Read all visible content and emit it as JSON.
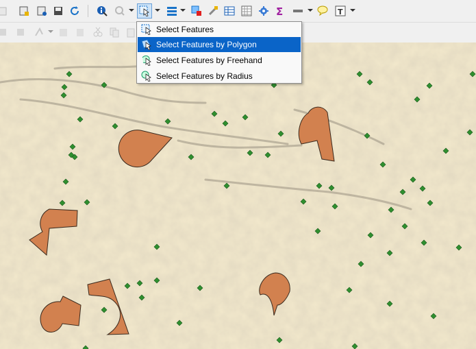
{
  "toolbar_top": {
    "buttons": [
      {
        "icon": "partial-icon"
      },
      {
        "icon": "new-layer-icon"
      },
      {
        "icon": "add-layer-icon"
      },
      {
        "icon": "save-edits-icon"
      },
      {
        "icon": "refresh-icon"
      },
      {
        "icon": "identify-icon"
      },
      {
        "icon": "action-icon"
      },
      {
        "icon": "select-features-icon",
        "active": true
      },
      {
        "icon": "open-attribute-table-icon"
      },
      {
        "icon": "deselect-icon"
      },
      {
        "icon": "field-calculator-icon"
      },
      {
        "icon": "attribute-table-icon"
      },
      {
        "icon": "statistics-icon"
      },
      {
        "icon": "toolbox-icon"
      },
      {
        "icon": "sum-icon"
      },
      {
        "icon": "measure-icon"
      },
      {
        "icon": "map-tips-icon"
      },
      {
        "icon": "text-annotation-icon"
      }
    ]
  },
  "select_menu": {
    "items": [
      {
        "label": "Select Features",
        "icon": "select-features-icon",
        "highlighted": false
      },
      {
        "label": "Select Features by Polygon",
        "icon": "select-by-polygon-icon",
        "highlighted": true
      },
      {
        "label": "Select Features by Freehand",
        "icon": "select-by-freehand-icon",
        "highlighted": false
      },
      {
        "label": "Select Features by Radius",
        "icon": "select-by-radius-icon",
        "highlighted": false
      }
    ]
  },
  "colors": {
    "map_background": "#f3e9cc",
    "polygon_fill": "#d2814f",
    "polygon_stroke": "#3a2a1e",
    "point_fill": "#2f8f2f",
    "menu_highlight": "#0a64c8"
  }
}
